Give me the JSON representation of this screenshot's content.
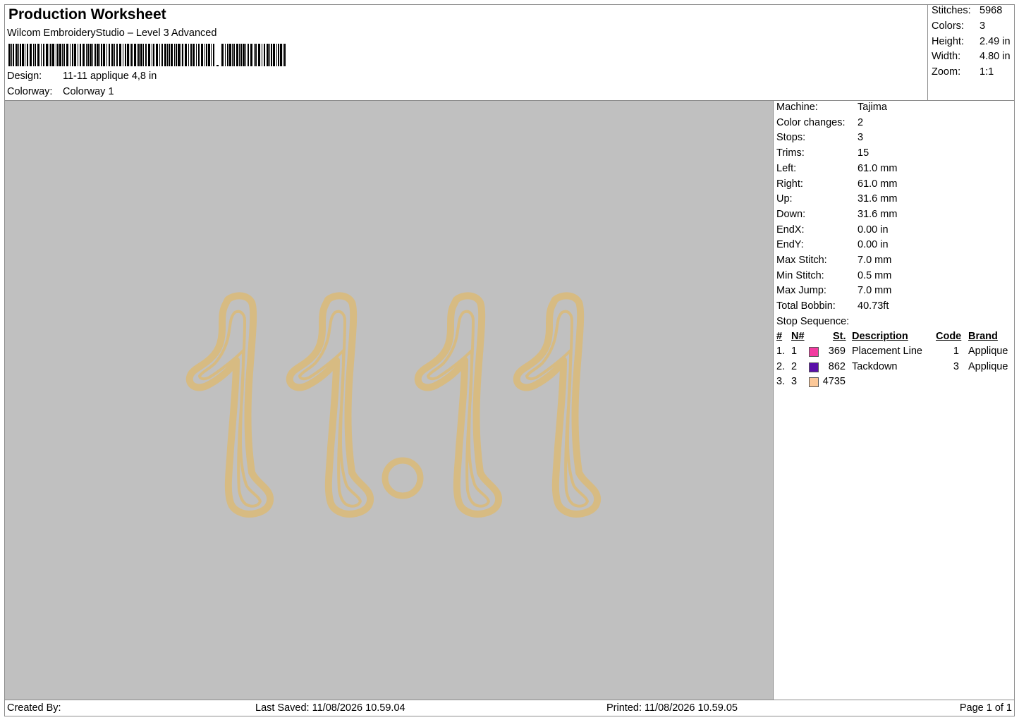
{
  "header": {
    "title": "Production Worksheet",
    "software": "Wilcom EmbroideryStudio – Level 3 Advanced",
    "design_label": "Design:",
    "design_value": "11-11 applique 4,8 in",
    "colorway_label": "Colorway:",
    "colorway_value": "Colorway 1"
  },
  "stats": {
    "stitches_label": "Stitches:",
    "stitches": "5968",
    "colors_label": "Colors:",
    "colors": "3",
    "height_label": "Height:",
    "height": "2.49 in",
    "width_label": "Width:",
    "width": "4.80 in",
    "zoom_label": "Zoom:",
    "zoom": "1:1"
  },
  "machine_info": [
    {
      "label": "Machine:",
      "value": "Tajima"
    },
    {
      "label": "Color changes:",
      "value": "2"
    },
    {
      "label": "Stops:",
      "value": "3"
    },
    {
      "label": "Trims:",
      "value": "15"
    },
    {
      "label": "Left:",
      "value": "61.0 mm"
    },
    {
      "label": "Right:",
      "value": "61.0 mm"
    },
    {
      "label": "Up:",
      "value": "31.6 mm"
    },
    {
      "label": "Down:",
      "value": "31.6 mm"
    },
    {
      "label": "EndX:",
      "value": "0.00 in"
    },
    {
      "label": "EndY:",
      "value": "0.00 in"
    },
    {
      "label": "Max Stitch:",
      "value": "7.0 mm"
    },
    {
      "label": "Min Stitch:",
      "value": "0.5 mm"
    },
    {
      "label": "Max Jump:",
      "value": "7.0 mm"
    },
    {
      "label": "Total Bobbin:",
      "value": "40.73ft"
    },
    {
      "label": "Stop Sequence:",
      "value": ""
    }
  ],
  "stop_table": {
    "headers": {
      "num": "#",
      "n": "N#",
      "st": "St.",
      "description": "Description",
      "code": "Code",
      "brand": "Brand"
    },
    "rows": [
      {
        "num": "1.",
        "n": "1",
        "color": "#f23ba0",
        "st": "369",
        "description": "Placement Line",
        "code": "1",
        "brand": "Applique"
      },
      {
        "num": "2.",
        "n": "2",
        "color": "#5a0fa8",
        "st": "862",
        "description": "Tackdown",
        "code": "3",
        "brand": "Applique"
      },
      {
        "num": "3.",
        "n": "3",
        "color": "#fcc898",
        "st": "4735",
        "description": "",
        "code": "",
        "brand": ""
      }
    ]
  },
  "design_preview": {
    "thread_color": "#d7bb82",
    "background_color": "#c0c0c0"
  },
  "footer": {
    "created_by": "Created By:",
    "last_saved": "Last Saved: 11/08/2026 10.59.04",
    "printed": "Printed: 11/08/2026 10.59.05",
    "page": "Page 1 of 1"
  }
}
